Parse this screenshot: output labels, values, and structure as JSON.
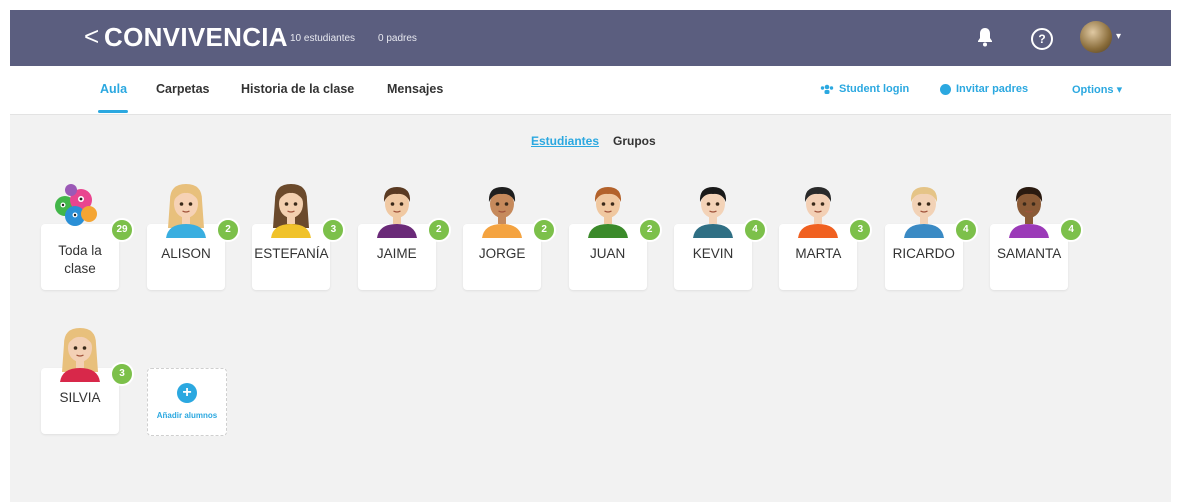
{
  "header": {
    "back_glyph": "<",
    "class_name": "CONVIVENCIA",
    "students_count": "10 estudiantes",
    "parents_count": "0 padres",
    "caret": "▾"
  },
  "nav": {
    "tabs": [
      {
        "label": "Aula"
      },
      {
        "label": "Carpetas"
      },
      {
        "label": "Historia de la clase"
      },
      {
        "label": "Mensajes"
      }
    ],
    "student_login": "Student login",
    "invite_parents": "Invitar padres",
    "options": "Options ▾"
  },
  "view_toggle": {
    "students": "Estudiantes",
    "groups": "Grupos"
  },
  "whole_class": {
    "label_line1": "Toda la",
    "label_line2": "clase",
    "points": "29"
  },
  "students": [
    {
      "name": "ALISON",
      "points": "2"
    },
    {
      "name": "ESTEFANÍA",
      "points": "3"
    },
    {
      "name": "JAIME",
      "points": "2"
    },
    {
      "name": "JORGE",
      "points": "2"
    },
    {
      "name": "JUAN",
      "points": "2"
    },
    {
      "name": "KEVIN",
      "points": "4"
    },
    {
      "name": "MARTA",
      "points": "3"
    },
    {
      "name": "RICARDO",
      "points": "4"
    },
    {
      "name": "SAMANTA",
      "points": "4"
    },
    {
      "name": "SILVIA",
      "points": "3"
    }
  ],
  "add_students": {
    "label": "Añadir alumnos",
    "glyph": "+"
  },
  "colors": {
    "header_bg": "#5b5e7f",
    "accent": "#2ba8e0",
    "badge": "#7cc04a"
  }
}
